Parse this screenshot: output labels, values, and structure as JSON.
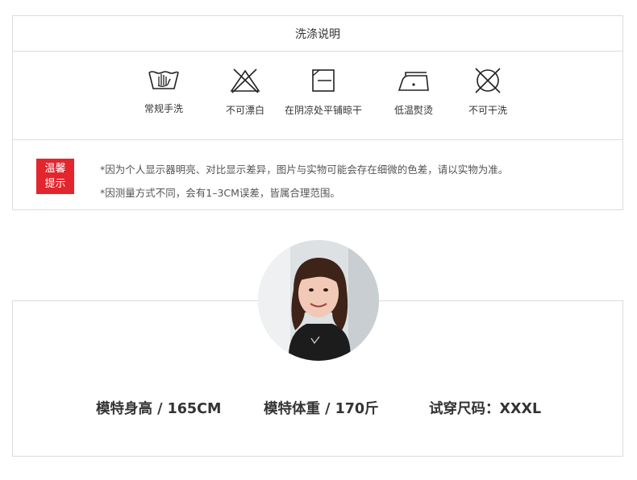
{
  "care": {
    "title": "洗涤说明",
    "items": [
      {
        "icon": "hand-wash-icon",
        "label": "常规手洗"
      },
      {
        "icon": "no-bleach-icon",
        "label": "不可漂白"
      },
      {
        "icon": "dry-flat-in-shade-icon",
        "label": "在阴凉处平铺晾干"
      },
      {
        "icon": "low-temperature-iron-icon",
        "label": "低温熨烫"
      },
      {
        "icon": "do-not-dry-clean-icon",
        "label": "不可干洗"
      }
    ]
  },
  "tips": {
    "badge_line1": "温馨",
    "badge_line2": "提示",
    "lines": [
      "*因为个人显示器明亮、对比显示差异，图片与实物可能会存在细微的色差，请以实物为准。",
      "*因测量方式不同，会有1–3CM误差，皆属合理范围。"
    ],
    "badge_color": "#e3252d"
  },
  "model": {
    "height": "模特身高 / 165CM",
    "weight": "模特体重 / 170斤",
    "size": "试穿尺码：XXXL"
  }
}
